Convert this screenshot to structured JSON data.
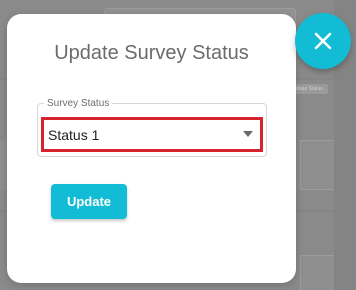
{
  "background": {
    "tag_text": "Update Status"
  },
  "dialog": {
    "title": "Update Survey Status",
    "field": {
      "label": "Survey Status",
      "selected_value": "Status 1"
    },
    "update_button": "Update",
    "close_icon": "close-icon"
  },
  "colors": {
    "accent": "#12bcd4",
    "highlight_border": "#d6232f"
  }
}
